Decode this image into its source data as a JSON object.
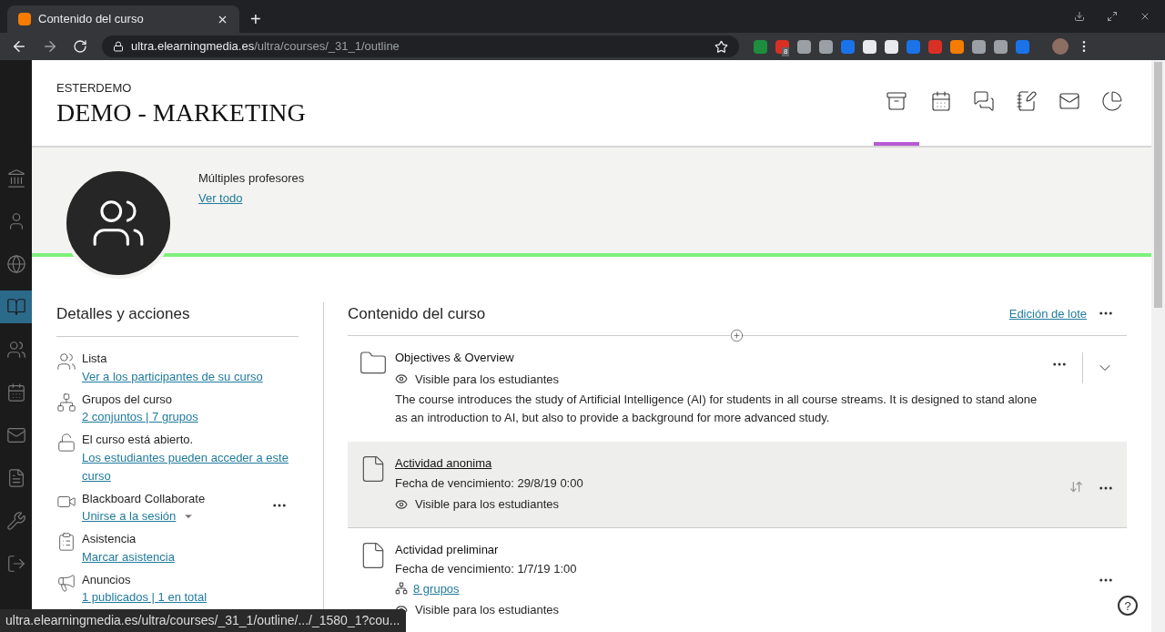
{
  "browser": {
    "tab_title": "Contenido del curso",
    "new_tab": "+",
    "url_host": "ultra.elearningmedia.es",
    "url_path": "/ultra/courses/_31_1/outline",
    "extension_badge": "8"
  },
  "sidebar": {
    "items": [
      {
        "kind": "institution",
        "selected": false
      },
      {
        "kind": "profile",
        "selected": false
      },
      {
        "kind": "globe",
        "selected": false
      },
      {
        "kind": "courses",
        "selected": true
      },
      {
        "kind": "groups",
        "selected": false
      },
      {
        "kind": "calendar",
        "selected": false
      },
      {
        "kind": "mail",
        "selected": false
      },
      {
        "kind": "grades",
        "selected": false
      },
      {
        "kind": "tools",
        "selected": false
      },
      {
        "kind": "logout",
        "selected": false
      }
    ]
  },
  "course": {
    "org": "ESTERDEMO",
    "title": "DEMO - MARKETING"
  },
  "nav_tabs": [
    {
      "kind": "content",
      "selected": true
    },
    {
      "kind": "calendar",
      "selected": false
    },
    {
      "kind": "discussions",
      "selected": false
    },
    {
      "kind": "gradebook",
      "selected": false
    },
    {
      "kind": "messages",
      "selected": false
    },
    {
      "kind": "analytics",
      "selected": false
    }
  ],
  "banner": {
    "label": "Múltiples profesores",
    "link": "Ver todo"
  },
  "details": {
    "heading": "Detalles y acciones",
    "items": [
      {
        "kind": "roster",
        "title": "Lista",
        "links": [
          "Ver a los participantes de su curso"
        ],
        "menu": false
      },
      {
        "kind": "groups",
        "title": "Grupos del curso",
        "links": [
          "2 conjuntos | 7 grupos"
        ],
        "menu": false
      },
      {
        "kind": "lock",
        "title": "El curso está abierto.",
        "links": [
          "Los estudiantes pueden acceder a este curso"
        ],
        "menu": false
      },
      {
        "kind": "video",
        "title": "Blackboard Collaborate",
        "links": [
          "Unirse a la sesión"
        ],
        "menu": true
      },
      {
        "kind": "attendance",
        "title": "Asistencia",
        "links": [
          "Marcar asistencia"
        ],
        "menu": false
      },
      {
        "kind": "announce",
        "title": "Anuncios",
        "links": [
          "1 publicados | 1 en total"
        ],
        "menu": false
      }
    ]
  },
  "content": {
    "heading": "Contenido del curso",
    "batch_edit": "Edición de lote",
    "items": [
      {
        "kind": "folder",
        "title": "Objectives & Overview",
        "visibility": "Visible para los estudiantes",
        "description": "The course introduces the study of Artificial Intelligence (AI) for students in all course streams. It is designed to stand alone as an introduction to AI, but also to provide a background for more advanced study.",
        "highlighted": false,
        "expandable": true
      },
      {
        "kind": "document",
        "title": "Actividad anonima",
        "due": "Fecha de vencimiento: 29/8/19 0:00",
        "visibility": "Visible para los estudiantes",
        "highlighted": true,
        "expandable": false
      },
      {
        "kind": "document",
        "title": "Actividad preliminar",
        "due": "Fecha de vencimiento: 1/7/19 1:00",
        "groups": "8 grupos",
        "visibility": "Visible para los estudiantes",
        "highlighted": false,
        "expandable": false
      }
    ]
  },
  "help": "?",
  "status_url": "ultra.elearningmedia.es/ultra/courses/_31_1/outline/.../_1580_1?cou..."
}
